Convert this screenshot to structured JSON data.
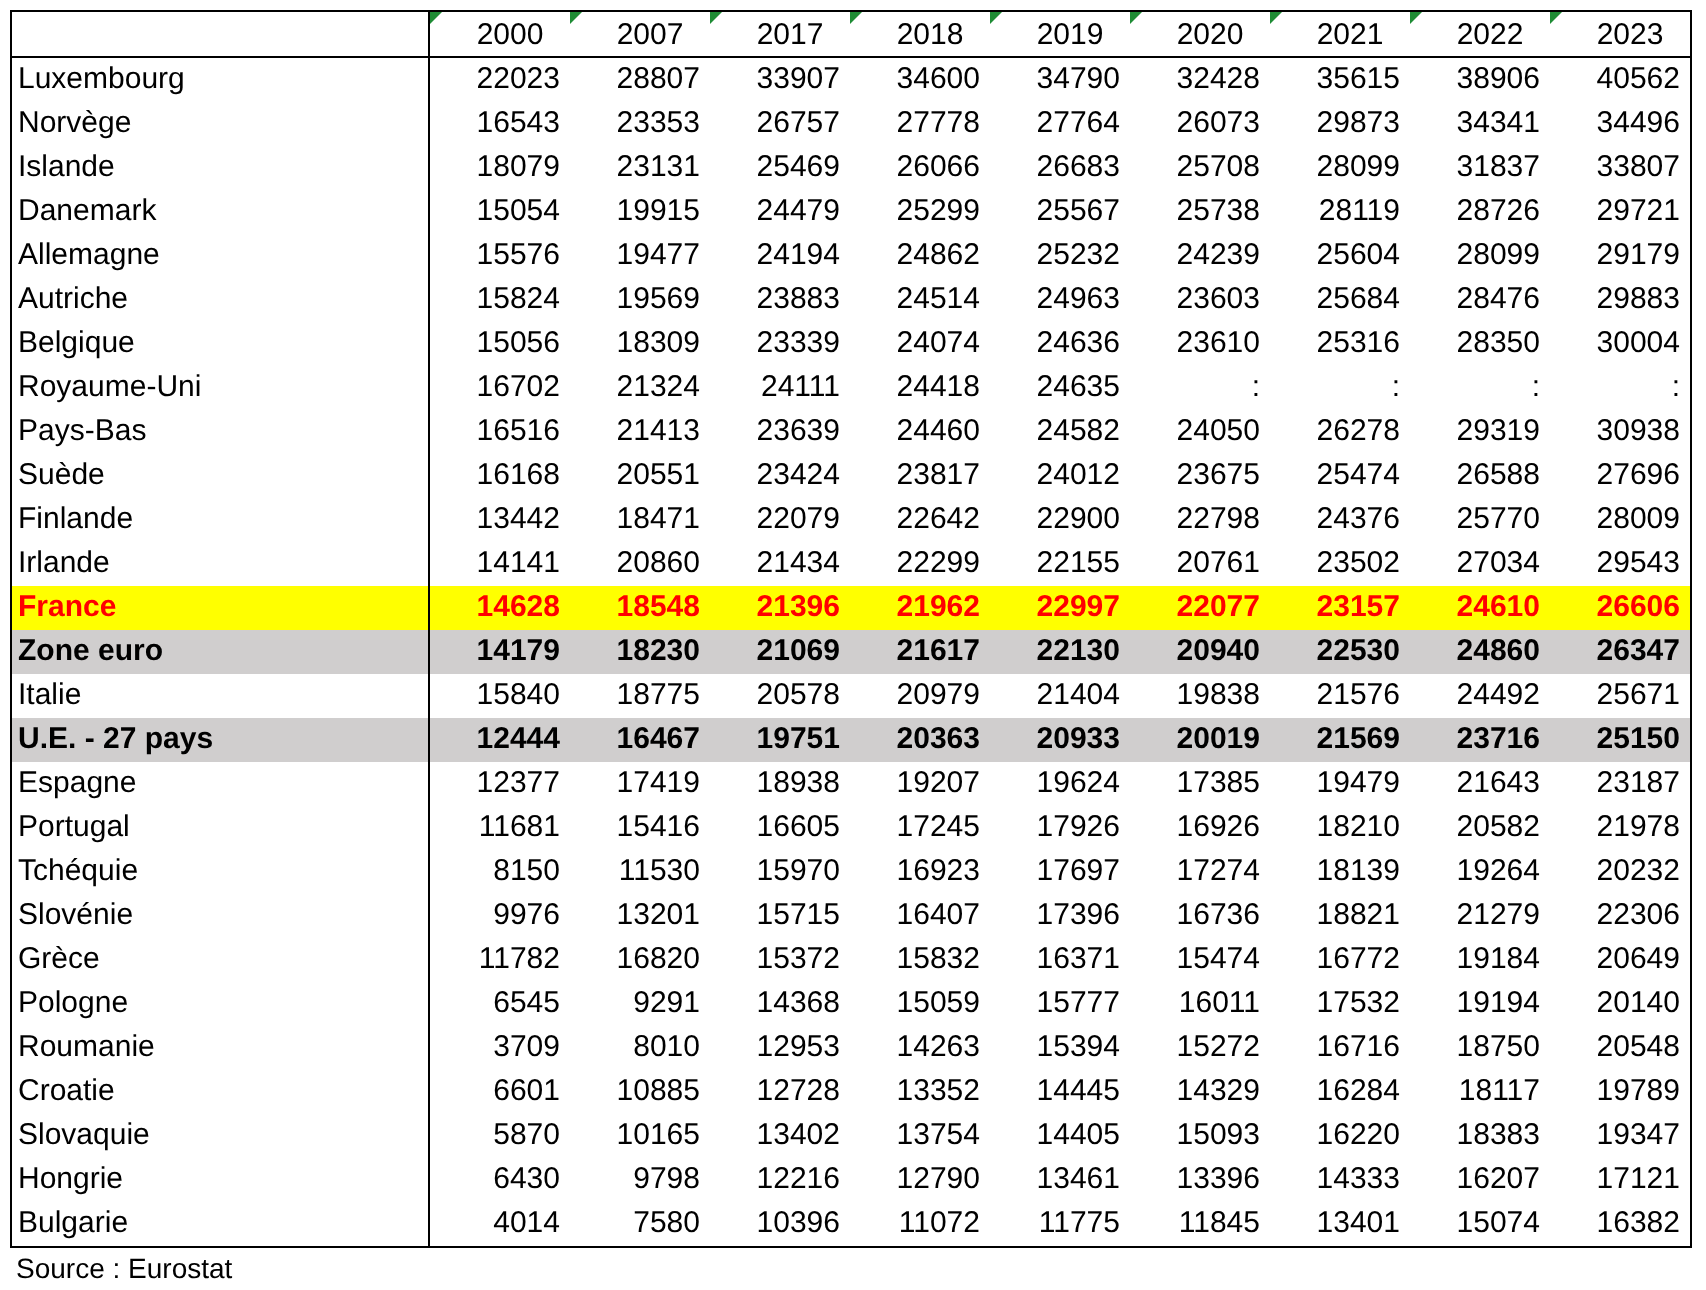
{
  "table": {
    "columns": [
      "2000",
      "2007",
      "2017",
      "2018",
      "2019",
      "2020",
      "2021",
      "2022",
      "2023"
    ],
    "rows": [
      {
        "kind": "normal",
        "label": "Luxembourg",
        "values": [
          "22023",
          "28807",
          "33907",
          "34600",
          "34790",
          "32428",
          "35615",
          "38906",
          "40562"
        ]
      },
      {
        "kind": "normal",
        "label": "Norvège",
        "values": [
          "16543",
          "23353",
          "26757",
          "27778",
          "27764",
          "26073",
          "29873",
          "34341",
          "34496"
        ]
      },
      {
        "kind": "normal",
        "label": "Islande",
        "values": [
          "18079",
          "23131",
          "25469",
          "26066",
          "26683",
          "25708",
          "28099",
          "31837",
          "33807"
        ]
      },
      {
        "kind": "normal",
        "label": "Danemark",
        "values": [
          "15054",
          "19915",
          "24479",
          "25299",
          "25567",
          "25738",
          "28119",
          "28726",
          "29721"
        ]
      },
      {
        "kind": "normal",
        "label": "Allemagne",
        "values": [
          "15576",
          "19477",
          "24194",
          "24862",
          "25232",
          "24239",
          "25604",
          "28099",
          "29179"
        ]
      },
      {
        "kind": "normal",
        "label": "Autriche",
        "values": [
          "15824",
          "19569",
          "23883",
          "24514",
          "24963",
          "23603",
          "25684",
          "28476",
          "29883"
        ]
      },
      {
        "kind": "normal",
        "label": "Belgique",
        "values": [
          "15056",
          "18309",
          "23339",
          "24074",
          "24636",
          "23610",
          "25316",
          "28350",
          "30004"
        ]
      },
      {
        "kind": "normal",
        "label": "Royaume-Uni",
        "values": [
          "16702",
          "21324",
          "24111",
          "24418",
          "24635",
          ":",
          ":",
          ":",
          ":"
        ]
      },
      {
        "kind": "normal",
        "label": "Pays-Bas",
        "values": [
          "16516",
          "21413",
          "23639",
          "24460",
          "24582",
          "24050",
          "26278",
          "29319",
          "30938"
        ]
      },
      {
        "kind": "normal",
        "label": "Suède",
        "values": [
          "16168",
          "20551",
          "23424",
          "23817",
          "24012",
          "23675",
          "25474",
          "26588",
          "27696"
        ]
      },
      {
        "kind": "normal",
        "label": "Finlande",
        "values": [
          "13442",
          "18471",
          "22079",
          "22642",
          "22900",
          "22798",
          "24376",
          "25770",
          "28009"
        ]
      },
      {
        "kind": "normal",
        "label": "Irlande",
        "values": [
          "14141",
          "20860",
          "21434",
          "22299",
          "22155",
          "20761",
          "23502",
          "27034",
          "29543"
        ]
      },
      {
        "kind": "highlight",
        "label": "France",
        "values": [
          "14628",
          "18548",
          "21396",
          "21962",
          "22997",
          "22077",
          "23157",
          "24610",
          "26606"
        ]
      },
      {
        "kind": "aggregate",
        "label": "Zone euro",
        "values": [
          "14179",
          "18230",
          "21069",
          "21617",
          "22130",
          "20940",
          "22530",
          "24860",
          "26347"
        ]
      },
      {
        "kind": "normal",
        "label": "Italie",
        "values": [
          "15840",
          "18775",
          "20578",
          "20979",
          "21404",
          "19838",
          "21576",
          "24492",
          "25671"
        ]
      },
      {
        "kind": "aggregate",
        "label": "U.E. - 27 pays",
        "values": [
          "12444",
          "16467",
          "19751",
          "20363",
          "20933",
          "20019",
          "21569",
          "23716",
          "25150"
        ]
      },
      {
        "kind": "normal",
        "label": "Espagne",
        "values": [
          "12377",
          "17419",
          "18938",
          "19207",
          "19624",
          "17385",
          "19479",
          "21643",
          "23187"
        ]
      },
      {
        "kind": "normal",
        "label": "Portugal",
        "values": [
          "11681",
          "15416",
          "16605",
          "17245",
          "17926",
          "16926",
          "18210",
          "20582",
          "21978"
        ]
      },
      {
        "kind": "normal",
        "label": "Tchéquie",
        "values": [
          "8150",
          "11530",
          "15970",
          "16923",
          "17697",
          "17274",
          "18139",
          "19264",
          "20232"
        ]
      },
      {
        "kind": "normal",
        "label": "Slovénie",
        "values": [
          "9976",
          "13201",
          "15715",
          "16407",
          "17396",
          "16736",
          "18821",
          "21279",
          "22306"
        ]
      },
      {
        "kind": "normal",
        "label": "Grèce",
        "values": [
          "11782",
          "16820",
          "15372",
          "15832",
          "16371",
          "15474",
          "16772",
          "19184",
          "20649"
        ]
      },
      {
        "kind": "normal",
        "label": "Pologne",
        "values": [
          "6545",
          "9291",
          "14368",
          "15059",
          "15777",
          "16011",
          "17532",
          "19194",
          "20140"
        ]
      },
      {
        "kind": "normal",
        "label": "Roumanie",
        "values": [
          "3709",
          "8010",
          "12953",
          "14263",
          "15394",
          "15272",
          "16716",
          "18750",
          "20548"
        ]
      },
      {
        "kind": "normal",
        "label": "Croatie",
        "values": [
          "6601",
          "10885",
          "12728",
          "13352",
          "14445",
          "14329",
          "16284",
          "18117",
          "19789"
        ]
      },
      {
        "kind": "normal",
        "label": "Slovaquie",
        "values": [
          "5870",
          "10165",
          "13402",
          "13754",
          "14405",
          "15093",
          "16220",
          "18383",
          "19347"
        ]
      },
      {
        "kind": "normal",
        "label": "Hongrie",
        "values": [
          "6430",
          "9798",
          "12216",
          "12790",
          "13461",
          "13396",
          "14333",
          "16207",
          "17121"
        ]
      },
      {
        "kind": "normal",
        "label": "Bulgarie",
        "values": [
          "4014",
          "7580",
          "10396",
          "11072",
          "11775",
          "11845",
          "13401",
          "15074",
          "16382"
        ]
      }
    ]
  },
  "source": "Source : Eurostat"
}
